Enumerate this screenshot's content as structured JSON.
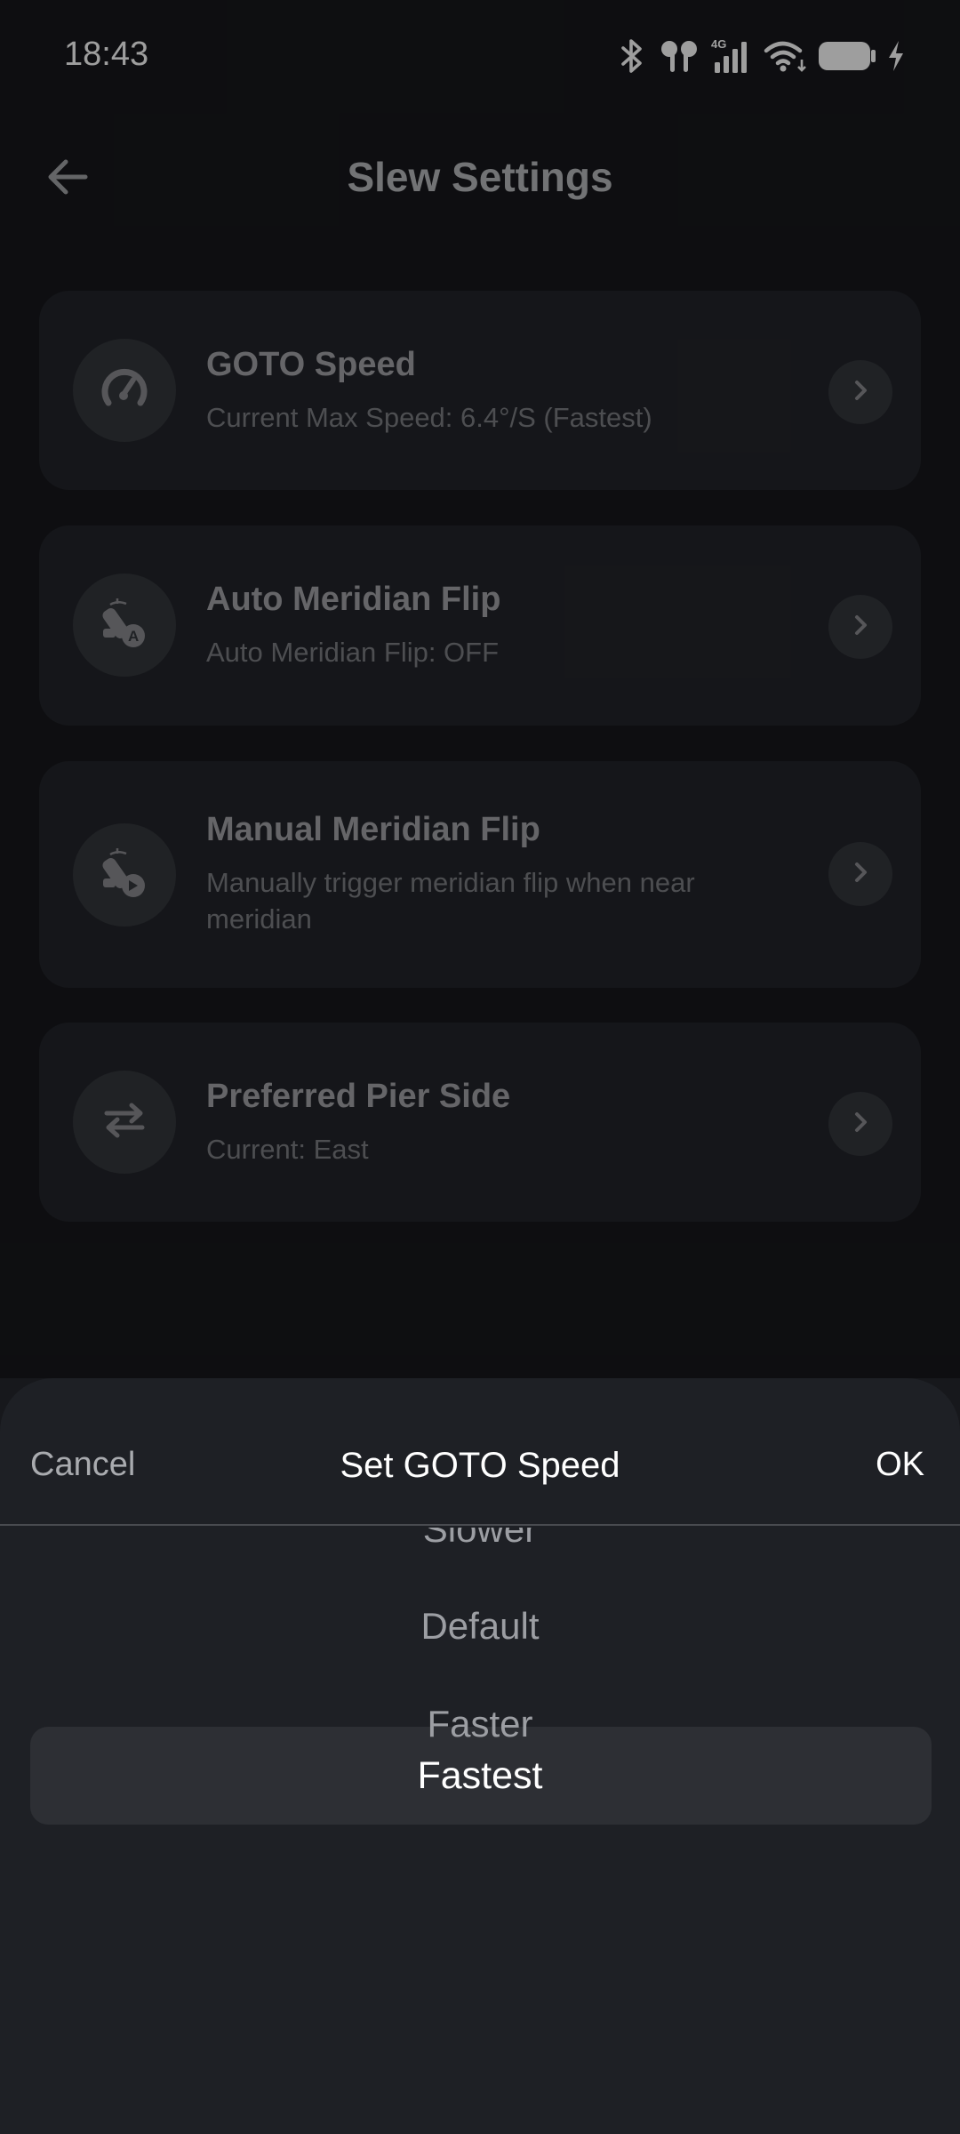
{
  "status_bar": {
    "time": "18:43",
    "network": "4G",
    "icons": [
      "bluetooth-icon",
      "earbuds-icon",
      "signal-icon",
      "wifi-icon",
      "battery-icon",
      "charging-icon"
    ]
  },
  "header": {
    "title": "Slew Settings",
    "back_icon": "arrow-left-icon"
  },
  "settings": [
    {
      "title": "GOTO Speed",
      "subtitle": "Current Max Speed: 6.4°/S (Fastest)",
      "icon": "speedometer-icon"
    },
    {
      "title": "Auto Meridian Flip",
      "subtitle": "Auto Meridian Flip: OFF",
      "icon": "telescope-auto-icon"
    },
    {
      "title": "Manual Meridian Flip",
      "subtitle": "Manually trigger meridian flip when near meridian",
      "icon": "telescope-manual-icon"
    },
    {
      "title": "Preferred Pier Side",
      "subtitle": "Current: East",
      "icon": "swap-arrows-icon"
    }
  ],
  "sheet": {
    "cancel_label": "Cancel",
    "title": "Set GOTO Speed",
    "ok_label": "OK",
    "options": [
      "Slower",
      "Default",
      "Faster",
      "Fastest"
    ],
    "selected": "Fastest"
  },
  "colors": {
    "background": "#101114",
    "card": "#23252a",
    "sheet": "#1e2025",
    "text_primary": "#ffffff",
    "text_muted": "#9c9ea3"
  }
}
